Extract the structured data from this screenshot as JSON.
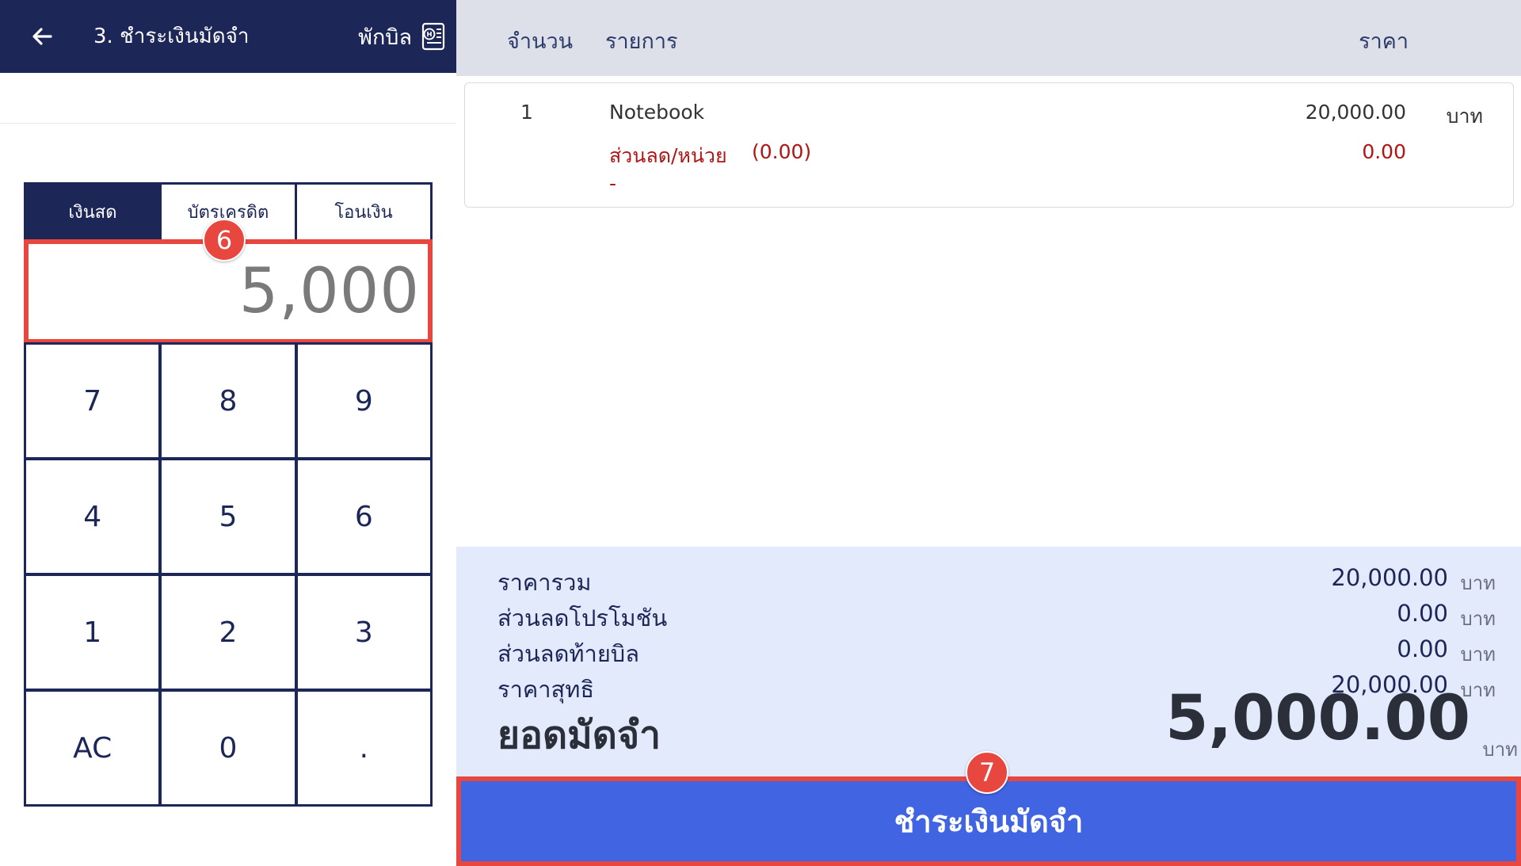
{
  "header": {
    "title": "3. ชำระเงินมัดจำ",
    "hold_bill_label": "พักบิล",
    "back_icon": "arrow-left-icon",
    "hold_icon": "receipt-icon"
  },
  "payment": {
    "tabs": [
      {
        "label": "เงินสด",
        "active": true
      },
      {
        "label": "บัตรเครดิต",
        "active": false
      },
      {
        "label": "โอนเงิน",
        "active": false
      }
    ],
    "amount": "5,000",
    "keys": [
      "7",
      "8",
      "9",
      "4",
      "5",
      "6",
      "1",
      "2",
      "3",
      "AC",
      "0",
      "."
    ]
  },
  "annotations": {
    "step_amount": "6",
    "step_pay": "7",
    "highlight_color": "#e8473f"
  },
  "table": {
    "headers": {
      "qty": "จำนวน",
      "item": "รายการ",
      "price": "ราคา"
    },
    "items": [
      {
        "qty": "1",
        "name": "Notebook",
        "price": "20,000.00",
        "unit": "บาท",
        "discount_label": "ส่วนลด/หน่วย",
        "discount_pct": "(0.00)",
        "discount_value": "0.00",
        "note": "-"
      }
    ]
  },
  "summary": {
    "rows": [
      {
        "label": "ราคารวม",
        "value": "20,000.00",
        "unit": "บาท"
      },
      {
        "label": "ส่วนลดโปรโมชัน",
        "value": "0.00",
        "unit": "บาท"
      },
      {
        "label": "ส่วนลดท้ายบิล",
        "value": "0.00",
        "unit": "บาท"
      },
      {
        "label": "ราคาสุทธิ",
        "value": "20,000.00",
        "unit": "บาท"
      }
    ],
    "deposit_label": "ยอดมัดจำ",
    "deposit_value": "5,000.00",
    "deposit_unit": "บาท"
  },
  "actions": {
    "pay_deposit_label": "ชำระเงินมัดจำ"
  },
  "colors": {
    "navy": "#1c2657",
    "primary_button": "#4164e3",
    "summary_bg": "#e3eafc",
    "discount_red": "#b01515"
  }
}
